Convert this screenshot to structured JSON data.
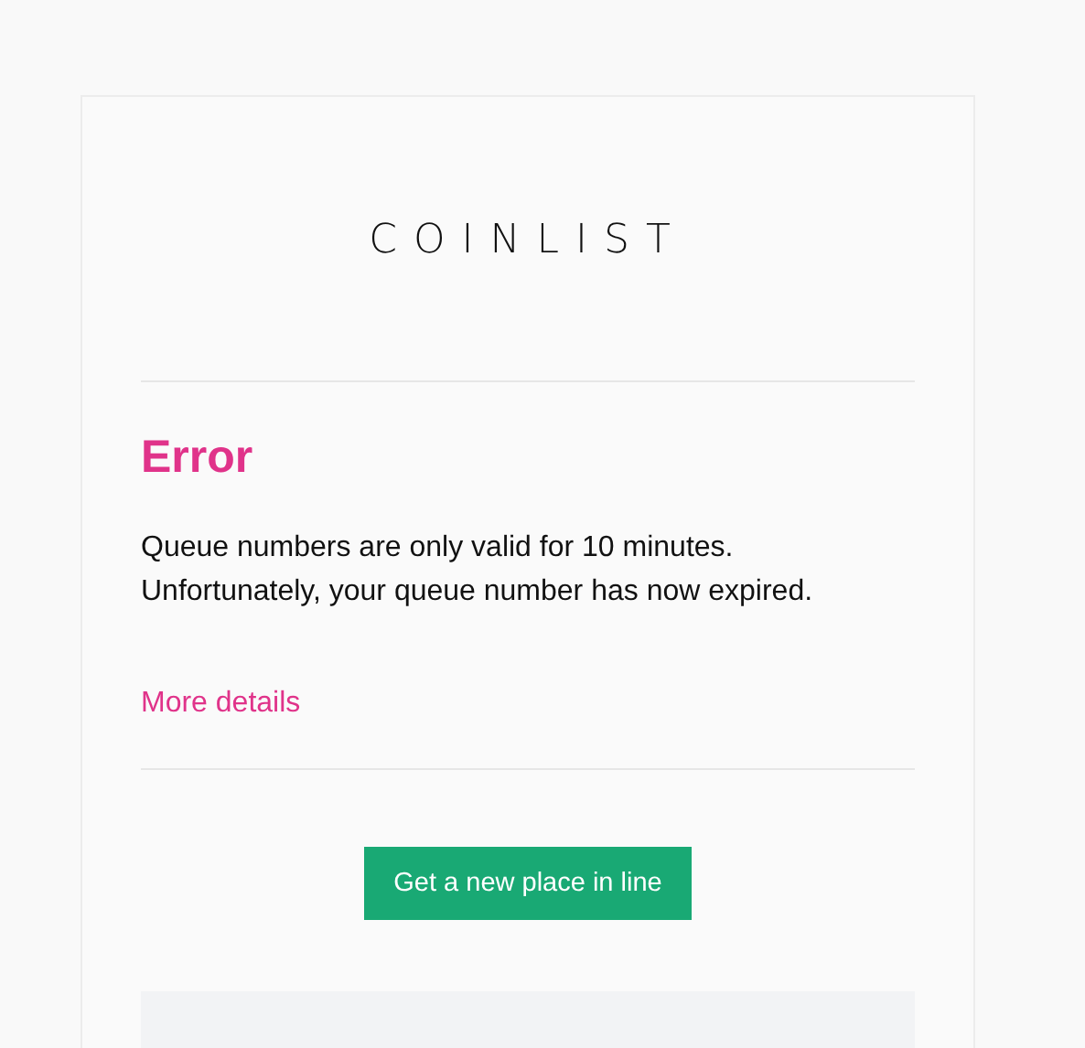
{
  "logo": "COINLIST",
  "heading": "Error",
  "message": [
    "Queue numbers are only valid for 10 minutes.",
    "Unfortunately, your queue number has now expired."
  ],
  "details_link": "More details",
  "button": "Get a new place in line"
}
